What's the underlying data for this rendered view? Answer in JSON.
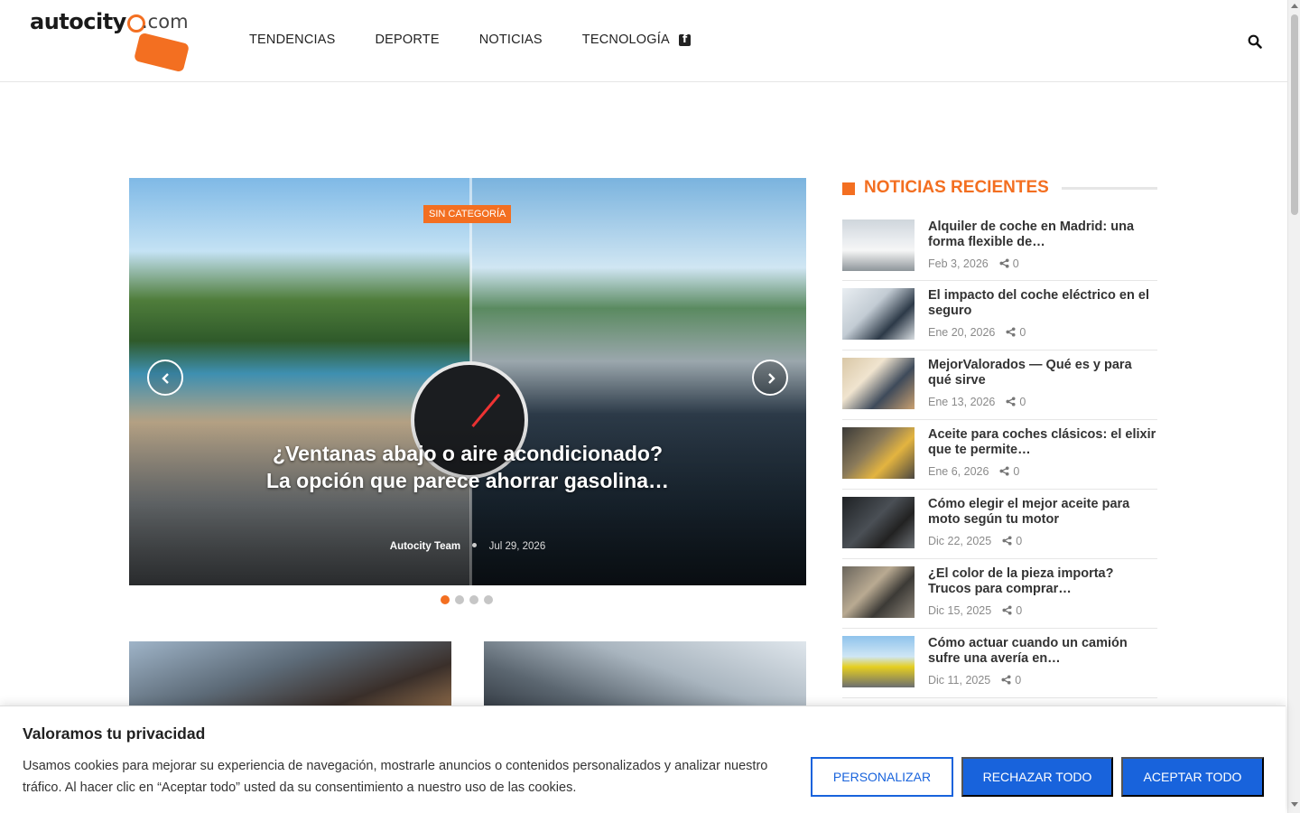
{
  "header": {
    "logo_main": "autocity",
    "logo_suffix": ".com",
    "nav": [
      {
        "label": "TENDENCIAS"
      },
      {
        "label": "DEPORTE"
      },
      {
        "label": "NOTICIAS"
      },
      {
        "label": "TECNOLOGÍA"
      }
    ]
  },
  "slider": {
    "category": "SIN CATEGORÍA",
    "title": "¿Ventanas abajo o aire acondicionado? La opción que parece ahorrar gasolina…",
    "author": "Autocity Team",
    "date": "Jul 29, 2026",
    "slide_count": 4,
    "active_slide": 1
  },
  "sidebar": {
    "widget_title": "NOTICIAS RECIENTES",
    "items": [
      {
        "title": "Alquiler de coche en Madrid: una forma flexible de…",
        "date": "Feb 3, 2026",
        "shares": "0"
      },
      {
        "title": "El impacto del coche eléctrico en el seguro",
        "date": "Ene 20, 2026",
        "shares": "0"
      },
      {
        "title": "MejorValorados — Qué es y para qué sirve",
        "date": "Ene 13, 2026",
        "shares": "0"
      },
      {
        "title": "Aceite para coches clásicos: el elixir que te permite…",
        "date": "Ene 6, 2026",
        "shares": "0"
      },
      {
        "title": "Cómo elegir el mejor aceite para moto según tu motor",
        "date": "Dic 22, 2025",
        "shares": "0"
      },
      {
        "title": "¿El color de la pieza importa? Trucos para comprar…",
        "date": "Dic 15, 2025",
        "shares": "0"
      },
      {
        "title": "Cómo actuar cuando un camión sufre una avería en…",
        "date": "Dic 11, 2025",
        "shares": "0"
      }
    ]
  },
  "cookie": {
    "title": "Valoramos tu privacidad",
    "text": "Usamos cookies para mejorar su experiencia de navegación, mostrarle anuncios o contenidos personalizados y analizar nuestro tráfico. Al hacer clic en “Aceptar todo” usted da su consentimiento a nuestro uso de las cookies.",
    "customize_label": "PERSONALIZAR",
    "reject_label": "RECHAZAR TODO",
    "accept_label": "ACEPTAR TODO"
  },
  "colors": {
    "accent": "#f36f21",
    "cookie_blue": "#1863dc"
  },
  "icons": {
    "facebook": "facebook-icon",
    "search": "search-icon",
    "prev": "chevron-left-icon",
    "next": "chevron-right-icon",
    "share": "share-icon"
  }
}
